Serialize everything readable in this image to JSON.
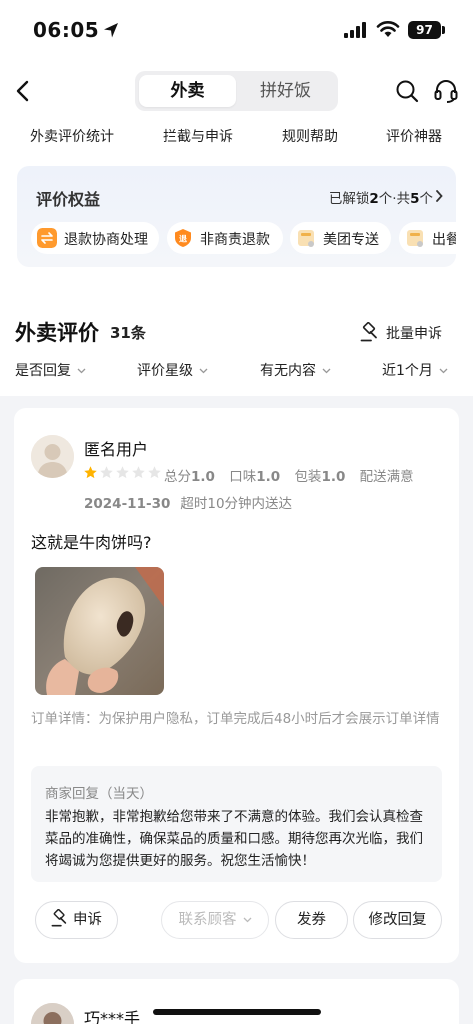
{
  "status_bar": {
    "time": "06:05",
    "battery": "97"
  },
  "header": {
    "tabs": [
      {
        "label": "外卖",
        "active": true
      },
      {
        "label": "拼好饭",
        "active": false
      }
    ]
  },
  "subnav": [
    "外卖评价统计",
    "拦截与申诉",
    "规则帮助",
    "评价神器"
  ],
  "rights": {
    "title": "评价权益",
    "unlocked_prefix": "已解锁",
    "unlocked": "2",
    "unlocked_unit": "个·共",
    "total": "5",
    "total_unit": "个",
    "chips": [
      {
        "label": "退款协商处理",
        "icon": "refund-negotiation-icon",
        "color": "#ff9a2e"
      },
      {
        "label": "非商责退款",
        "icon": "non-merchant-refund-icon",
        "color": "#ff8a1f"
      },
      {
        "label": "美团专送",
        "icon": "meituan-delivery-icon",
        "color": "#f5c66e"
      },
      {
        "label": "出餐",
        "icon": "meal-out-icon",
        "color": "#f5c66e"
      }
    ]
  },
  "reviews": {
    "title": "外卖评价",
    "count": "31条",
    "batch_appeal": "批量申诉",
    "filters": [
      "是否回复",
      "评价星级",
      "有无内容",
      "近1个月"
    ]
  },
  "review_1": {
    "user": "匿名用户",
    "rating": 1,
    "scores": [
      {
        "label": "总分",
        "value": "1.0"
      },
      {
        "label": "口味",
        "value": "1.0"
      },
      {
        "label": "包装",
        "value": "1.0"
      },
      {
        "label": "配送满意",
        "value": ""
      }
    ],
    "date": "2024-11-30",
    "delivery_note": "超时10分钟内送达",
    "text": "这就是牛肉饼吗?",
    "order_detail": "订单详情：为保护用户隐私，订单完成后48小时后才会展示订单详情",
    "reply_head": "商家回复（当天）",
    "reply_text": "非常抱歉，非常抱歉给您带来了不满意的体验。我们会认真检查菜品的准确性，确保菜品的质量和口感。期待您再次光临，我们将竭诚为您提供更好的服务。祝您生活愉快！",
    "actions": {
      "appeal": "申诉",
      "contact": "联系顾客",
      "coupon": "发券",
      "edit_reply": "修改回复"
    }
  },
  "review_2": {
    "user": "巧***手"
  }
}
